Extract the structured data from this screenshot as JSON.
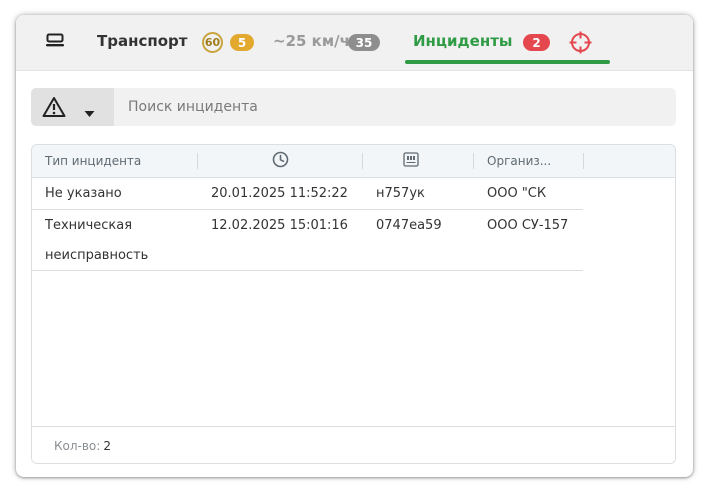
{
  "tabs": {
    "transport_label": "Транспорт",
    "speed_circle": "60",
    "speed_badge": "5",
    "speed_label": "~25 км/ч",
    "speed_count": "35",
    "incidents_label": "Инциденты",
    "incidents_count": "2"
  },
  "search": {
    "placeholder": "Поиск инцидента"
  },
  "table": {
    "columns": [
      "Тип инцидента",
      "",
      "",
      "Организ..."
    ],
    "rows": [
      {
        "type": "Не указано",
        "type2": "",
        "datetime": "20.01.2025 11:52:22",
        "plate": "н757ук",
        "org": "ООО \"СК"
      },
      {
        "type": "Техническая",
        "type2": "неисправность",
        "datetime": "12.02.2025 15:01:16",
        "plate": "0747еа59",
        "org": "ООО СУ-157"
      }
    ]
  },
  "footer": {
    "count_label": "Кол-во:",
    "count_value": "2"
  },
  "colors": {
    "accent_green": "#2f9b45",
    "badge_red": "#e4474e",
    "badge_yellow": "#e3a92e",
    "badge_gray": "#8e8e8e"
  },
  "icons": [
    "vehicle-icon",
    "warning-icon",
    "chevron-down-icon",
    "clock-icon",
    "license-plate-icon",
    "crosshair-icon"
  ]
}
